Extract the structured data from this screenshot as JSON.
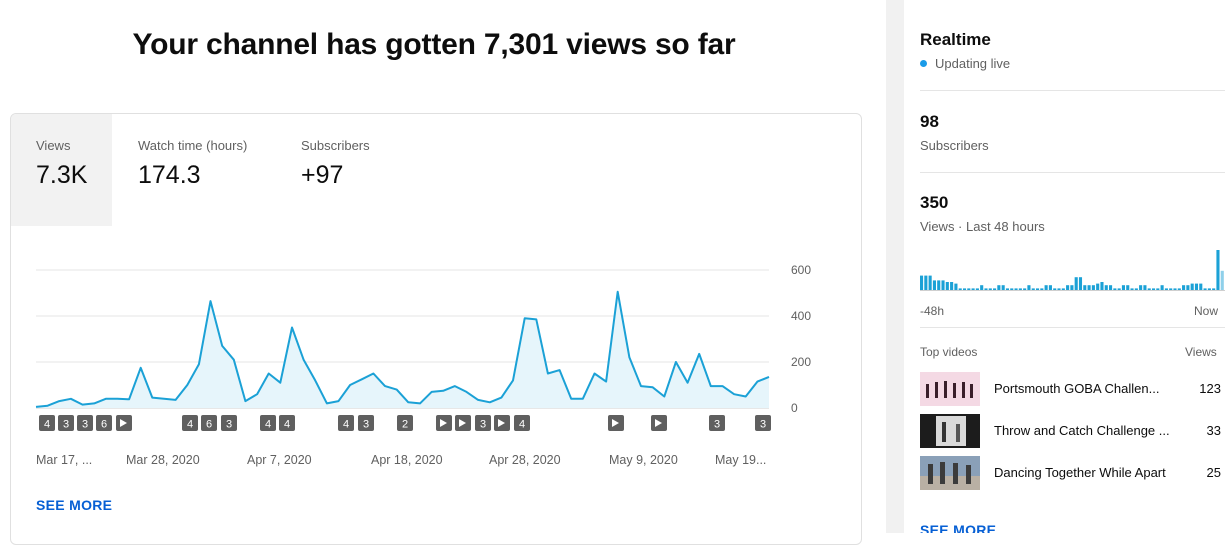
{
  "headline": "Your channel has gotten 7,301 views so far",
  "tabs": [
    {
      "label": "Views",
      "value": "7.3K"
    },
    {
      "label": "Watch time (hours)",
      "value": "174.3"
    },
    {
      "label": "Subscribers",
      "value": "+97"
    }
  ],
  "colors": {
    "accent": "#1ba1d6",
    "link": "#065fd4",
    "marker": "#5f5f5f"
  },
  "chart_data": {
    "type": "area",
    "y_ticks": [
      "600",
      "400",
      "200",
      "0"
    ],
    "ylim": [
      0,
      600
    ],
    "x_labels": [
      "Mar 17, ...",
      "Mar 28, 2020",
      "Apr 7, 2020",
      "Apr 18, 2020",
      "Apr 28, 2020",
      "May 9, 2020",
      "May 19..."
    ],
    "values": [
      5,
      10,
      30,
      40,
      15,
      20,
      40,
      40,
      38,
      175,
      45,
      40,
      35,
      100,
      190,
      465,
      270,
      210,
      30,
      60,
      150,
      110,
      350,
      210,
      120,
      20,
      30,
      100,
      125,
      150,
      95,
      80,
      25,
      20,
      70,
      75,
      95,
      70,
      35,
      25,
      45,
      120,
      390,
      385,
      150,
      165,
      40,
      40,
      150,
      115,
      505,
      220,
      95,
      90,
      50,
      200,
      110,
      235,
      95,
      95,
      60,
      50,
      115,
      135
    ],
    "markers": [
      "4",
      "3",
      "3",
      "6",
      "play",
      "4",
      "6",
      "3",
      "4",
      "4",
      "4",
      "3",
      "2",
      "play",
      "play",
      "3",
      "play",
      "4",
      "play",
      "play",
      "3",
      "3"
    ]
  },
  "see_more_main": "SEE MORE",
  "realtime": {
    "title": "Realtime",
    "live": "Updating live",
    "subscribers_value": "98",
    "subscribers_label": "Subscribers",
    "views_value": "350",
    "views_label": "Views · Last 48 hours",
    "axis_start": "-48h",
    "axis_end": "Now",
    "bars": [
      9,
      9,
      9,
      6,
      6,
      6,
      5,
      5,
      4,
      1,
      1,
      1,
      1,
      1,
      3,
      1,
      1,
      1,
      3,
      3,
      1,
      1,
      1,
      1,
      1,
      3,
      1,
      1,
      1,
      3,
      3,
      1,
      1,
      1,
      3,
      3,
      8,
      8,
      3,
      3,
      3,
      4,
      5,
      3,
      3,
      1,
      1,
      3,
      3,
      1,
      1,
      3,
      3,
      1,
      1,
      1,
      3,
      1,
      1,
      1,
      1,
      3,
      3,
      4,
      4,
      4,
      1,
      1,
      1,
      25,
      12
    ],
    "top_videos_label": "Top videos",
    "views_col_label": "Views",
    "top_videos": [
      {
        "title": "Portsmouth GOBA Challen...",
        "views": "123"
      },
      {
        "title": "Throw and Catch Challenge ...",
        "views": "33"
      },
      {
        "title": "Dancing Together While Apart",
        "views": "25"
      }
    ],
    "see_more": "SEE MORE"
  }
}
